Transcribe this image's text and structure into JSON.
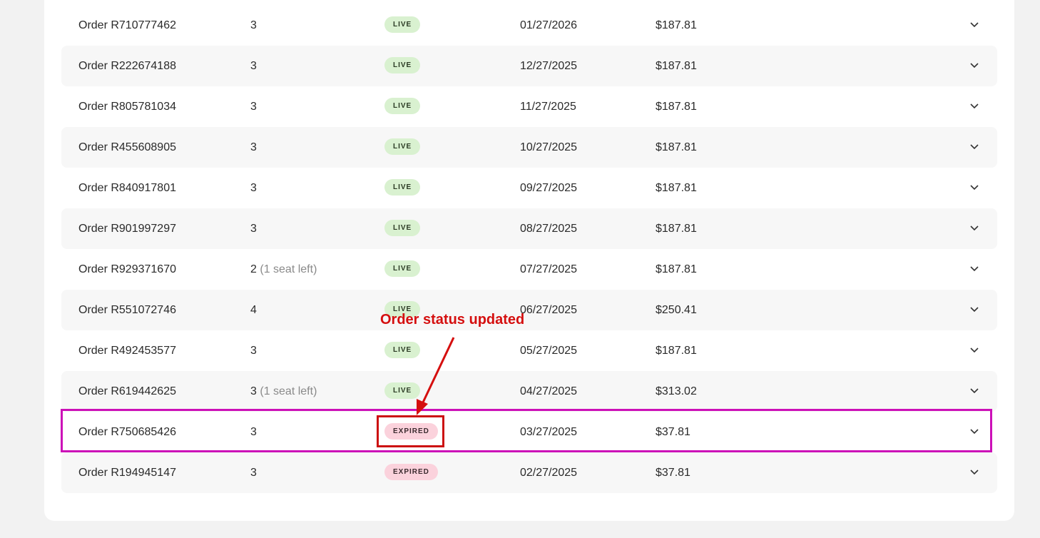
{
  "orders": [
    {
      "order": "Order R710777462",
      "seats": "3",
      "note": "",
      "status": "LIVE",
      "date": "01/27/2026",
      "total": "$187.81"
    },
    {
      "order": "Order R222674188",
      "seats": "3",
      "note": "",
      "status": "LIVE",
      "date": "12/27/2025",
      "total": "$187.81"
    },
    {
      "order": "Order R805781034",
      "seats": "3",
      "note": "",
      "status": "LIVE",
      "date": "11/27/2025",
      "total": "$187.81"
    },
    {
      "order": "Order R455608905",
      "seats": "3",
      "note": "",
      "status": "LIVE",
      "date": "10/27/2025",
      "total": "$187.81"
    },
    {
      "order": "Order R840917801",
      "seats": "3",
      "note": "",
      "status": "LIVE",
      "date": "09/27/2025",
      "total": "$187.81"
    },
    {
      "order": "Order R901997297",
      "seats": "3",
      "note": "",
      "status": "LIVE",
      "date": "08/27/2025",
      "total": "$187.81"
    },
    {
      "order": "Order R929371670",
      "seats": "2",
      "note": "(1 seat left)",
      "status": "LIVE",
      "date": "07/27/2025",
      "total": "$187.81"
    },
    {
      "order": "Order R551072746",
      "seats": "4",
      "note": "",
      "status": "LIVE",
      "date": "06/27/2025",
      "total": "$250.41"
    },
    {
      "order": "Order R492453577",
      "seats": "3",
      "note": "",
      "status": "LIVE",
      "date": "05/27/2025",
      "total": "$187.81"
    },
    {
      "order": "Order R619442625",
      "seats": "3",
      "note": "(1 seat left)",
      "status": "LIVE",
      "date": "04/27/2025",
      "total": "$313.02"
    },
    {
      "order": "Order R750685426",
      "seats": "3",
      "note": "",
      "status": "EXPIRED",
      "date": "03/27/2025",
      "total": "$37.81"
    },
    {
      "order": "Order R194945147",
      "seats": "3",
      "note": "",
      "status": "EXPIRED",
      "date": "02/27/2025",
      "total": "$37.81"
    }
  ],
  "annotation": {
    "text": "Order status updated",
    "color": "#d50f0f",
    "highlight_row_color": "#cc10b8"
  },
  "icons": {
    "row_toggle": "chevron-down-icon"
  },
  "colors": {
    "live_badge_bg": "#d9f1d0",
    "expired_badge_bg": "#fbd2dc",
    "stripe_bg": "#f7f7f7"
  }
}
